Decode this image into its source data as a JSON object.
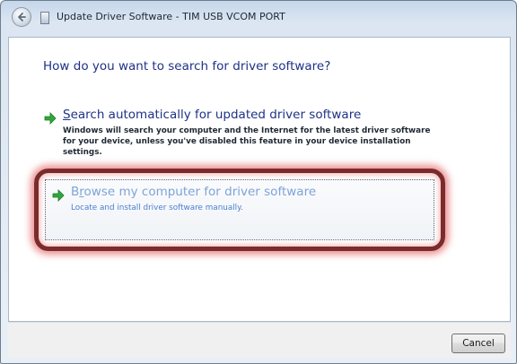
{
  "window": {
    "title": "Update Driver Software - TIM USB VCOM PORT"
  },
  "main": {
    "heading": "How do you want to search for driver software?",
    "options": [
      {
        "title_accel": "S",
        "title_rest": "earch automatically for updated driver software",
        "description": "Windows will search your computer and the Internet for the latest driver software for your device, unless you've disabled this feature in your device installation settings.",
        "icon": "green-arrow-icon"
      },
      {
        "title_pre": "B",
        "title_accel": "r",
        "title_rest": "owse my computer for driver software",
        "description": "Locate and install driver software manually.",
        "icon": "green-arrow-icon"
      }
    ]
  },
  "footer": {
    "cancel_label": "Cancel"
  },
  "colors": {
    "heading": "#1e3287",
    "highlight_ring": "#7a2b2b",
    "hover_text": "#7fa3d8",
    "arrow": "#2fa83a"
  }
}
